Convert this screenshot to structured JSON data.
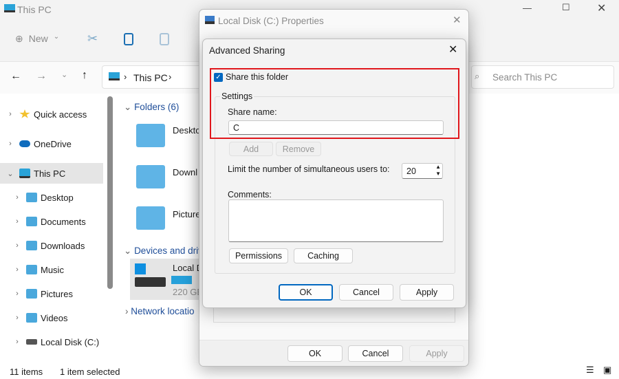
{
  "explorer": {
    "title": "This PC",
    "toolbar": {
      "new_label": "New"
    },
    "breadcrumb": [
      "This PC"
    ],
    "search_placeholder": "Search This PC",
    "sidebar": [
      {
        "label": "Quick access",
        "level": 0
      },
      {
        "label": "OneDrive",
        "level": 0
      },
      {
        "label": "This PC",
        "level": 0,
        "selected": true
      },
      {
        "label": "Desktop",
        "level": 1
      },
      {
        "label": "Documents",
        "level": 1
      },
      {
        "label": "Downloads",
        "level": 1
      },
      {
        "label": "Music",
        "level": 1
      },
      {
        "label": "Pictures",
        "level": 1
      },
      {
        "label": "Videos",
        "level": 1
      },
      {
        "label": "Local Disk (C:)",
        "level": 1
      }
    ],
    "sections": {
      "folders": "Folders (6)",
      "devices": "Devices and driv",
      "network": "Network locatio"
    },
    "folders": [
      "Deskto",
      "Downl",
      "Picture"
    ],
    "drive": {
      "name": "Local D",
      "size": "220 GE",
      "used_fraction": 0.6
    },
    "status": {
      "items": "11 items",
      "selected": "1 item selected"
    },
    "colors": {
      "accent": "#0067c0",
      "highlight": "#e0161b"
    }
  },
  "properties": {
    "title": "Local Disk (C:) Properties",
    "ok": "OK",
    "cancel": "Cancel",
    "apply": "Apply"
  },
  "advanced": {
    "title": "Advanced Sharing",
    "share_checkbox": "Share this folder",
    "share_checked": true,
    "settings_label": "Settings",
    "share_name_label": "Share name:",
    "share_name_value": "C",
    "add": "Add",
    "remove": "Remove",
    "limit_label": "Limit the number of simultaneous users to:",
    "limit_value": "20",
    "comments_label": "Comments:",
    "comments_value": "",
    "permissions": "Permissions",
    "caching": "Caching",
    "ok": "OK",
    "cancel": "Cancel",
    "apply": "Apply"
  }
}
